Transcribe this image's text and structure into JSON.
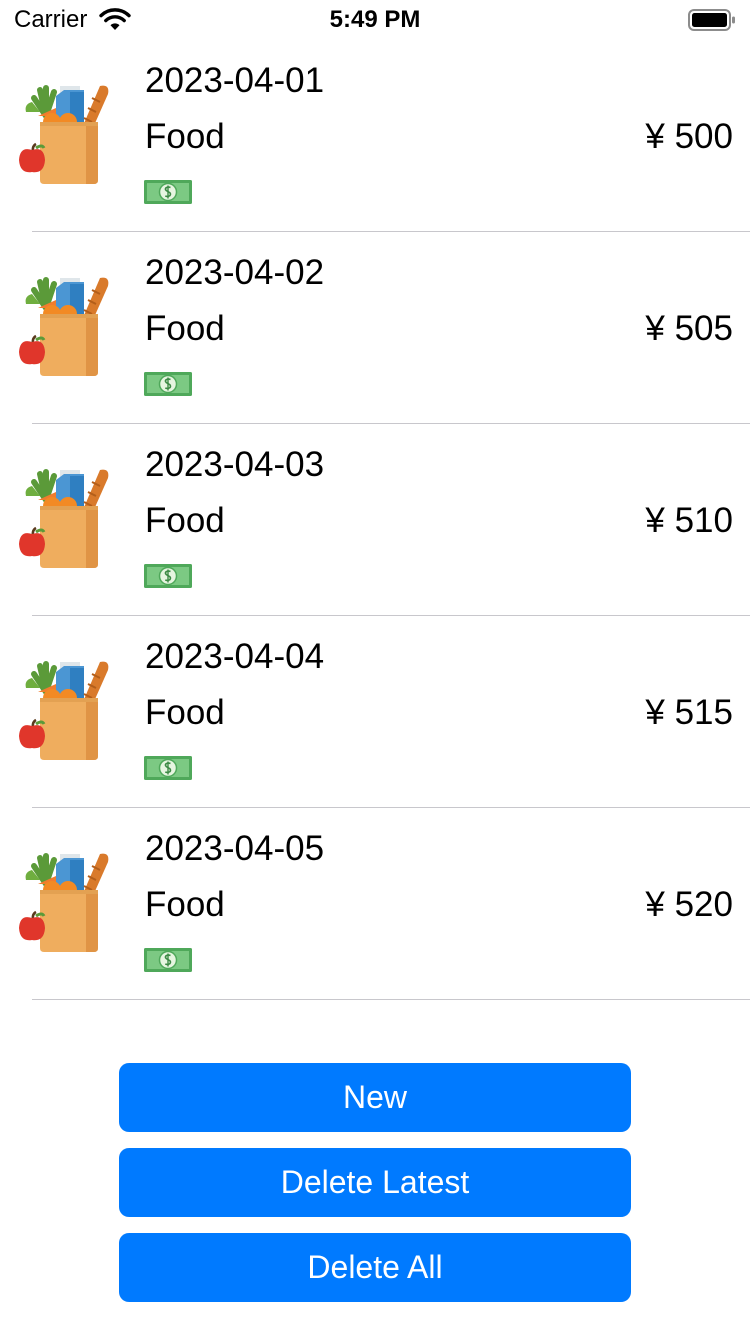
{
  "status_bar": {
    "carrier": "Carrier",
    "time": "5:49 PM"
  },
  "colors": {
    "accent": "#007aff",
    "divider": "#c8c7cc"
  },
  "records": [
    {
      "date": "2023-04-01",
      "category": "Food",
      "amount": "¥ 500",
      "category_icon": "grocery-bag-icon",
      "payment_icon": "cash-icon"
    },
    {
      "date": "2023-04-02",
      "category": "Food",
      "amount": "¥ 505",
      "category_icon": "grocery-bag-icon",
      "payment_icon": "cash-icon"
    },
    {
      "date": "2023-04-03",
      "category": "Food",
      "amount": "¥ 510",
      "category_icon": "grocery-bag-icon",
      "payment_icon": "cash-icon"
    },
    {
      "date": "2023-04-04",
      "category": "Food",
      "amount": "¥ 515",
      "category_icon": "grocery-bag-icon",
      "payment_icon": "cash-icon"
    },
    {
      "date": "2023-04-05",
      "category": "Food",
      "amount": "¥ 520",
      "category_icon": "grocery-bag-icon",
      "payment_icon": "cash-icon"
    }
  ],
  "actions": {
    "new_label": "New",
    "delete_latest_label": "Delete Latest",
    "delete_all_label": "Delete All"
  }
}
